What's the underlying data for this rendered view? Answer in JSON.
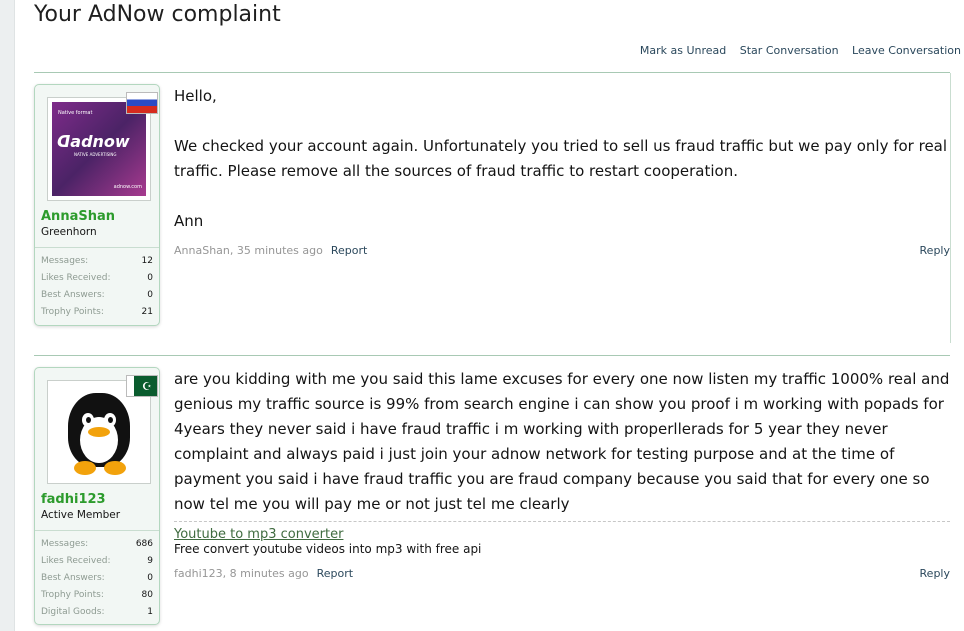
{
  "page": {
    "title": "Your AdNow complaint"
  },
  "controls": {
    "mark_unread": "Mark as Unread",
    "star": "Star Conversation",
    "leave": "Leave Conversation"
  },
  "messages": [
    {
      "user": {
        "name": "AnnaShan",
        "title": "Greenhorn",
        "flag": "russia-flag",
        "avatar": {
          "caption": "Native format",
          "logo": "adnow",
          "tagline": "NATIVE ADVERTISING",
          "domain": "adnow.com"
        },
        "stats": [
          {
            "label": "Messages:",
            "value": "12"
          },
          {
            "label": "Likes Received:",
            "value": "0"
          },
          {
            "label": "Best Answers:",
            "value": "0"
          },
          {
            "label": "Trophy Points:",
            "value": "21"
          }
        ]
      },
      "paragraphs": [
        "Hello,",
        "We checked your account again. Unfortunately you tried to sell us fraud traffic but we pay only for real traffic. Please remove all the sources of fraud traffic to restart cooperation.",
        "Ann"
      ],
      "meta": "AnnaShan, 35 minutes ago",
      "report": "Report",
      "reply": "Reply"
    },
    {
      "user": {
        "name": "fadhi123",
        "title": "Active Member",
        "flag": "pakistan-flag",
        "avatar": {
          "icon": "penguin-icon"
        },
        "stats": [
          {
            "label": "Messages:",
            "value": "686"
          },
          {
            "label": "Likes Received:",
            "value": "9"
          },
          {
            "label": "Best Answers:",
            "value": "0"
          },
          {
            "label": "Trophy Points:",
            "value": "80"
          },
          {
            "label": "Digital Goods:",
            "value": "1"
          }
        ]
      },
      "paragraphs": [
        "are you kidding with me you said this lame excuses for every one now listen my traffic 1000% real and genious my traffic source is 99% from search engine i can show you proof i m working with popads for 4years they never said i have fraud traffic i m working with properllerads for 5 year they never complaint and always paid i just join your adnow network for testing purpose and at the time of payment you said i have fraud traffic you are fraud company because you said that for every one so now tel me you will pay me or not just tel me clearly"
      ],
      "signature": {
        "link": "Youtube to mp3 converter",
        "text": "Free convert youtube videos into mp3 with free api"
      },
      "meta": "fadhi123, 8 minutes ago",
      "report": "Report",
      "reply": "Reply"
    }
  ]
}
